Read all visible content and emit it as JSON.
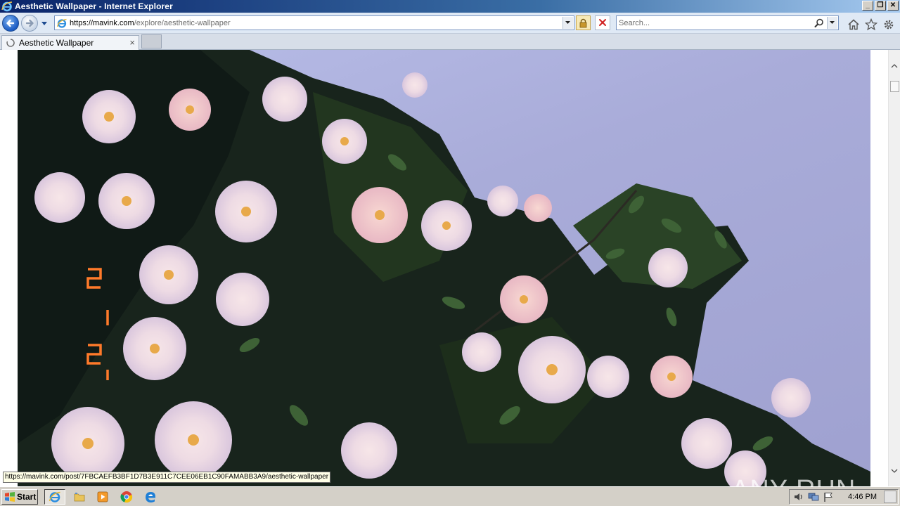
{
  "window": {
    "title": "Aesthetic Wallpaper - Internet Explorer",
    "minimize": "_",
    "maximize": "❐",
    "close": "✕"
  },
  "address_bar": {
    "url_host": "https://mavink.com",
    "url_path": "/explore/aesthetic-wallpaper"
  },
  "search": {
    "placeholder": "Search..."
  },
  "tabs": [
    {
      "label": "Aesthetic Wallpaper",
      "close": "×"
    }
  ],
  "status_link": "https://mavink.com/post/7FBCAEFB3BF1D7B3E911C7CEE06EB1C90FAMABB3A9/aesthetic-wallpaper",
  "watermark": {
    "text": "ANY RUN"
  },
  "image": {
    "description_icon": "flower-photo",
    "date_stamp": "5 15 '"
  },
  "taskbar": {
    "start_label": "Start",
    "clock": "4:46 PM",
    "items": [
      "internet-explorer-icon",
      "file-explorer-icon",
      "media-player-icon",
      "chrome-icon",
      "edge-icon"
    ]
  },
  "colors": {
    "title_bar": "#0a246a",
    "nav_bar": "#dfe9f5",
    "sky": "#a9acd9",
    "taskbar": "#d4d0c8"
  }
}
